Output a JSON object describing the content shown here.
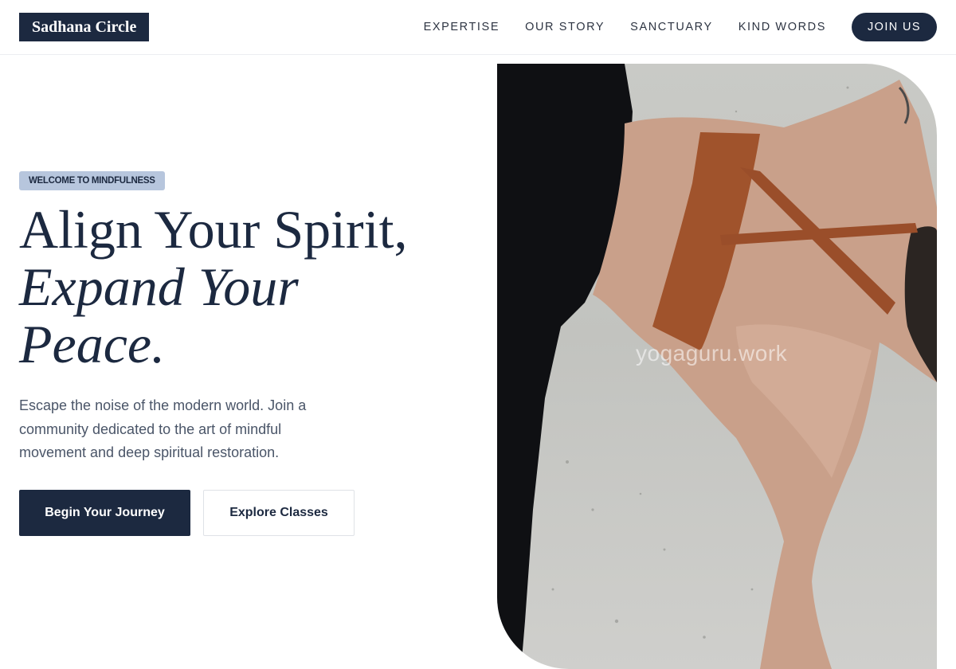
{
  "brand": "Sadhana Circle",
  "nav": {
    "links": [
      "EXPERTISE",
      "OUR STORY",
      "SANCTUARY",
      "KIND WORDS"
    ],
    "cta": "JOIN US"
  },
  "hero": {
    "badge": "WELCOME TO MINDFULNESS",
    "headline_line1": "Align Your Spirit,",
    "headline_line2": "Expand Your",
    "headline_line3": "Peace.",
    "lede": "Escape the noise of the modern world. Join a community dedicated to the art of mindful movement and deep spiritual restoration.",
    "primary_cta": "Begin Your Journey",
    "secondary_cta": "Explore Classes",
    "watermark": "yogaguru.work"
  },
  "colors": {
    "navy": "#1c2940",
    "badge": "#b7c6dd",
    "body_text": "#4a5568",
    "bra": "#a0532c"
  }
}
